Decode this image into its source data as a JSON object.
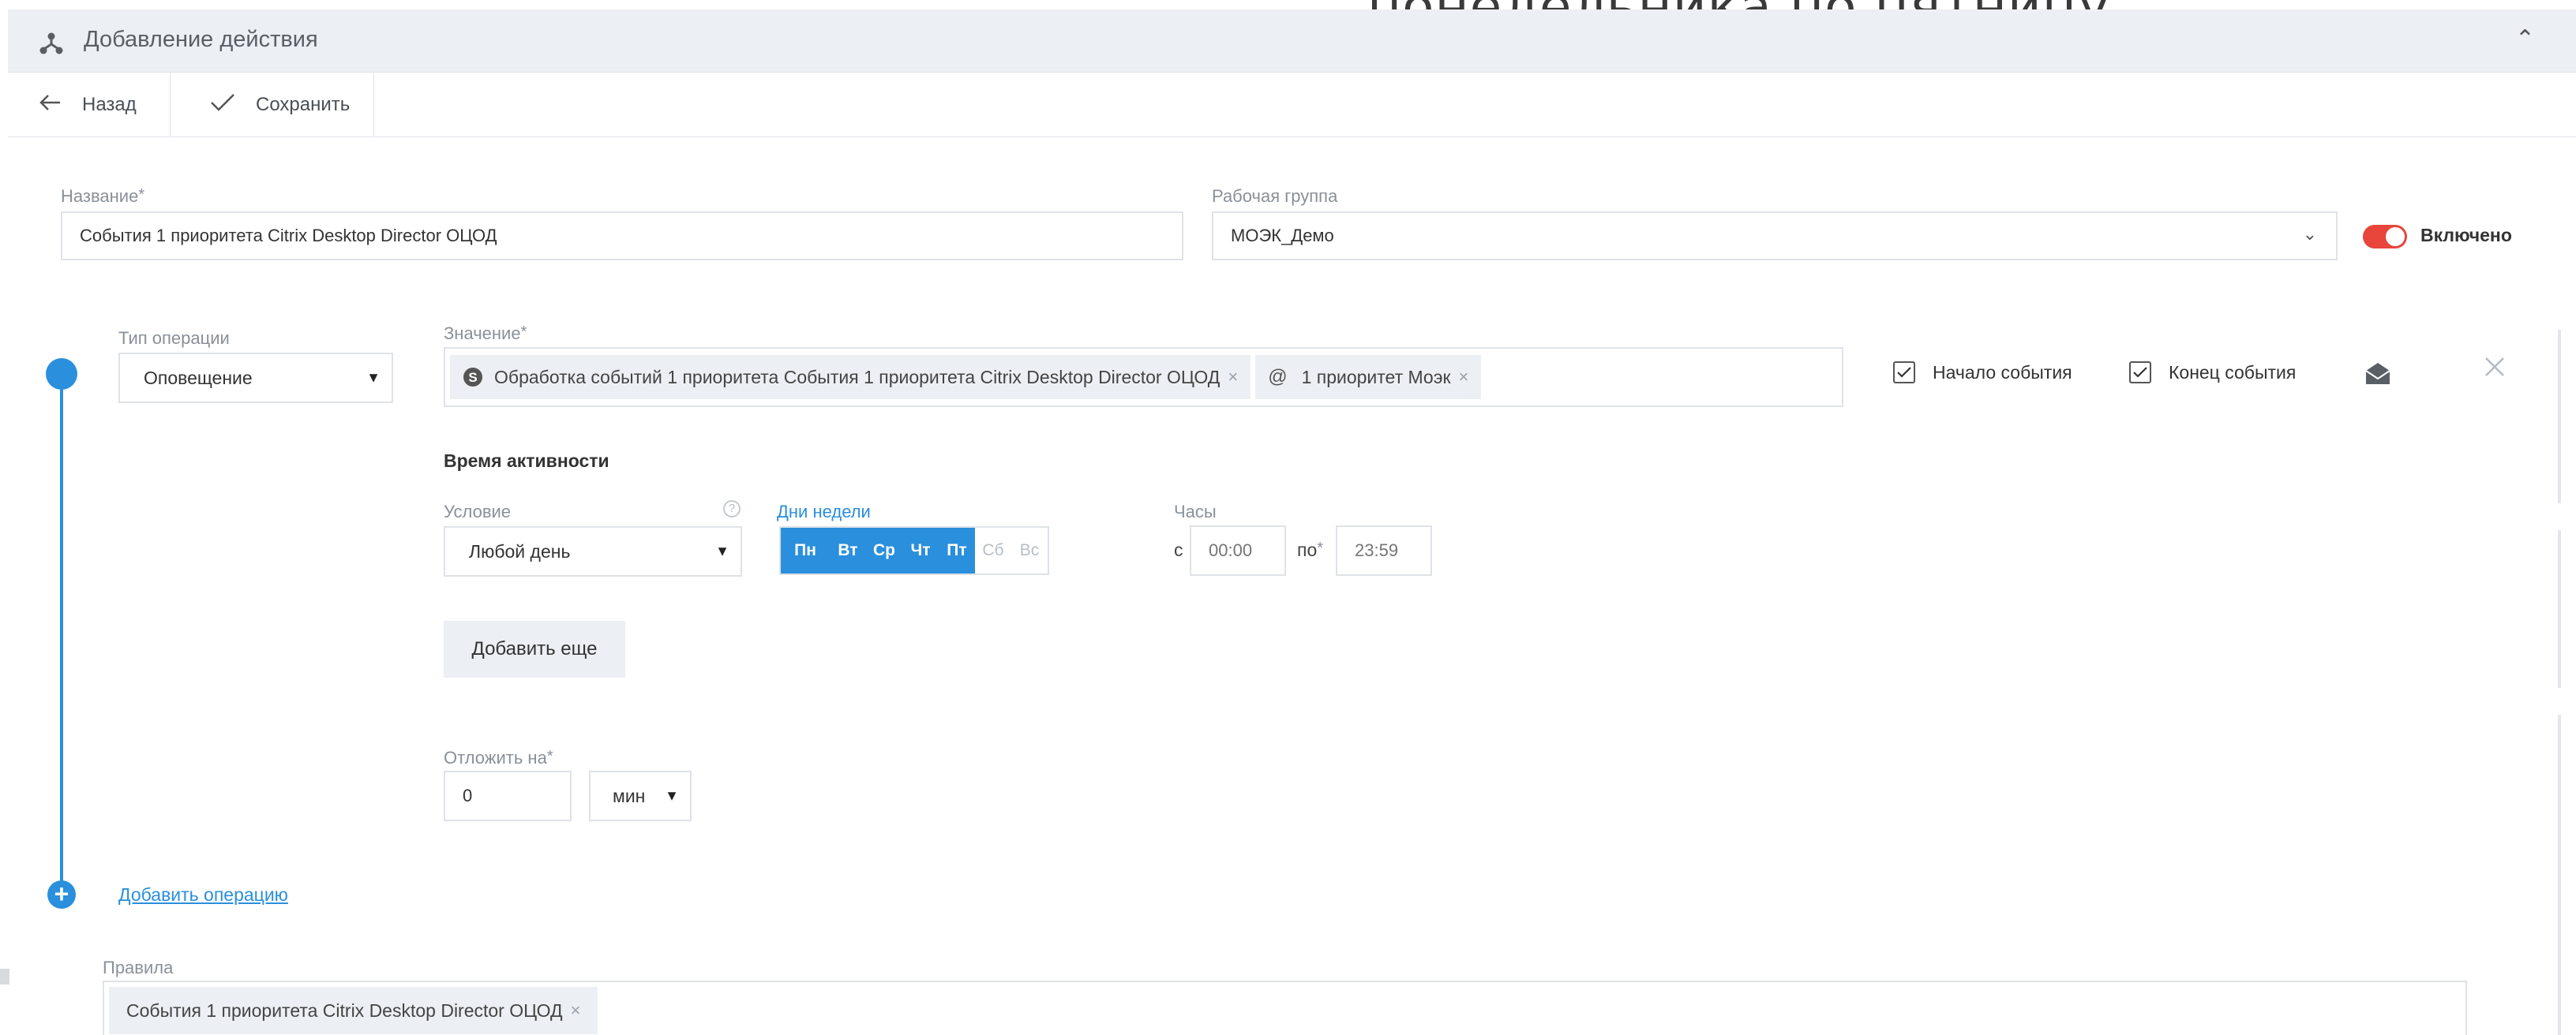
{
  "overlay_text": "понедельника по пятницу.",
  "window": {
    "title": "Добавление действия"
  },
  "toolbar": {
    "back_label": "Назад",
    "save_label": "Сохранить"
  },
  "form": {
    "name_label": "Название",
    "name_value": "События 1 приоритета Citrix Desktop Director ОЦОД",
    "group_label": "Рабочая группа",
    "group_value": "МОЭК_Демо",
    "enabled_label": "Включено",
    "enabled": true
  },
  "operation": {
    "type_label": "Тип операции",
    "type_value": "Оповещение",
    "value_label": "Значение",
    "tags": [
      {
        "icon": "skype-icon",
        "label": "Обработка событий 1 приоритета События 1 приоритета Citrix Desktop Director ОЦОД"
      },
      {
        "icon": "at-sign-icon",
        "label": "1 приоритет Моэк"
      }
    ],
    "event_start_label": "Начало события",
    "event_start_checked": true,
    "event_end_label": "Конец события",
    "event_end_checked": true
  },
  "activity": {
    "title": "Время активности",
    "condition_label": "Условие",
    "condition_value": "Любой день",
    "weekdays_label": "Дни недели",
    "weekdays": [
      {
        "label": "Пн",
        "active": true
      },
      {
        "label": "Вт",
        "active": true
      },
      {
        "label": "Ср",
        "active": true
      },
      {
        "label": "Чт",
        "active": true
      },
      {
        "label": "Пт",
        "active": true
      },
      {
        "label": "Сб",
        "active": false
      },
      {
        "label": "Вс",
        "active": false
      }
    ],
    "hours_label": "Часы",
    "from_label": "с",
    "from_placeholder": "00:00",
    "to_label": "по",
    "to_placeholder": "23:59",
    "add_more_label": "Добавить еще"
  },
  "delay": {
    "label": "Отложить на",
    "value": "0",
    "unit": "мин"
  },
  "add_operation_label": "Добавить операцию",
  "rules": {
    "label": "Правила",
    "tags": [
      "События 1 приоритета Citrix Desktop Director ОЦОД"
    ]
  },
  "colors": {
    "accent": "#2a8fdc",
    "toggle_on": "#e8453c",
    "header_bg": "#eceff3"
  }
}
